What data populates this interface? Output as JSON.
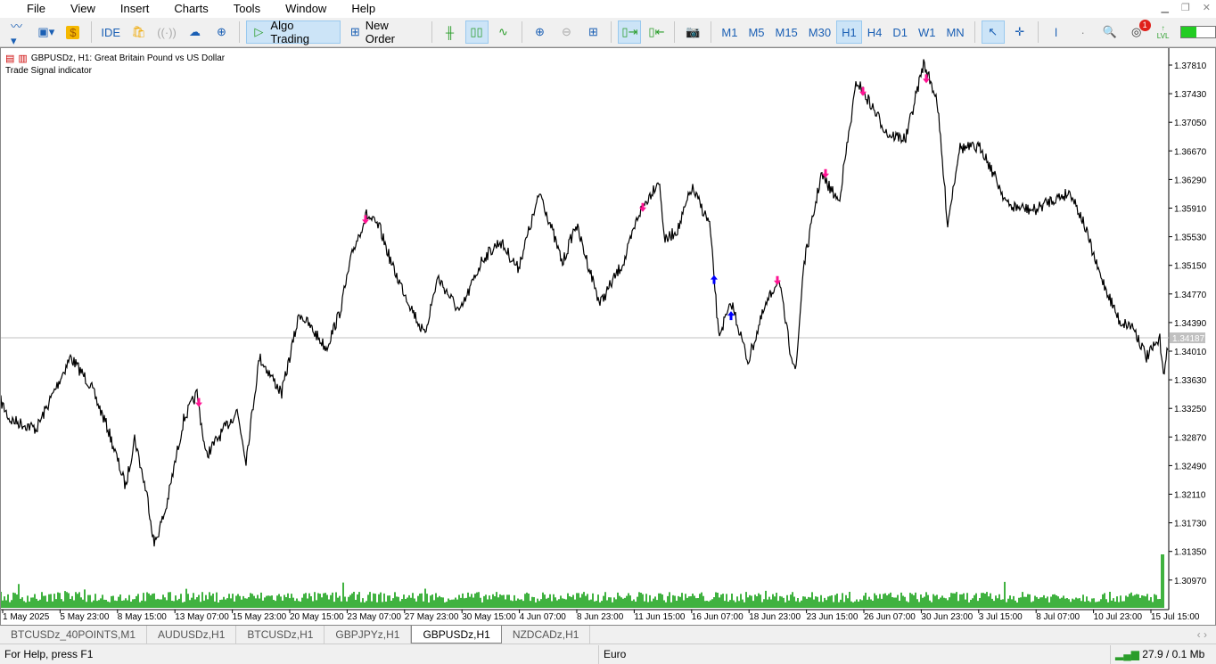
{
  "menu": [
    "File",
    "View",
    "Insert",
    "Charts",
    "Tools",
    "Window",
    "Help"
  ],
  "toolbar": {
    "ide": "IDE",
    "algo_trading": "Algo Trading",
    "new_order": "New Order",
    "timeframes": [
      "M1",
      "M5",
      "M15",
      "M30",
      "H1",
      "H4",
      "D1",
      "W1",
      "MN"
    ],
    "active_timeframe": "H1",
    "notification_count": "1",
    "lvl": "LVL"
  },
  "chart": {
    "symbol_title": "GBPUSDz, H1:  Great Britain Pound vs US Dollar",
    "indicator": "Trade Signal indicator",
    "current_price": "1.34187",
    "price_ticks": [
      "1.37810",
      "1.37430",
      "1.37050",
      "1.36670",
      "1.36290",
      "1.35910",
      "1.35530",
      "1.35150",
      "1.34770",
      "1.34390",
      "1.34010",
      "1.33630",
      "1.33250",
      "1.32870",
      "1.32490",
      "1.32110",
      "1.31730",
      "1.31350",
      "1.30970"
    ],
    "time_ticks": [
      "1 May 2025",
      "5 May 23:00",
      "8 May 15:00",
      "13 May 07:00",
      "15 May 23:00",
      "20 May 15:00",
      "23 May 07:00",
      "27 May 23:00",
      "30 May 15:00",
      "4 Jun 07:00",
      "8 Jun 23:00",
      "11 Jun 15:00",
      "16 Jun 07:00",
      "18 Jun 23:00",
      "23 Jun 15:00",
      "26 Jun 07:00",
      "30 Jun 23:00",
      "3 Jul 15:00",
      "8 Jul 07:00",
      "10 Jul 23:00",
      "15 Jul 15:00"
    ],
    "colors": {
      "price_line": "#000000",
      "sell_arrow": "#ff1493",
      "buy_arrow": "#0000ff",
      "volume": "#009900",
      "bid_line": "#c0c0c0"
    }
  },
  "chart_data": {
    "type": "line",
    "symbol": "GBPUSDz",
    "timeframe": "H1",
    "ylim": [
      1.3059,
      1.3819
    ],
    "bars": [
      0,
      10,
      40,
      78,
      100,
      120,
      140,
      150,
      165,
      172,
      185,
      205,
      220,
      230,
      265,
      275,
      290,
      315,
      335,
      365,
      380,
      395,
      410,
      425,
      440,
      475,
      490,
      515,
      540,
      560,
      580,
      605,
      630,
      645,
      672,
      700,
      715,
      738,
      745,
      760,
      775,
      795,
      800,
      805,
      820,
      838,
      855,
      872,
      885,
      892,
      900,
      920,
      940,
      960,
      975,
      995,
      1015,
      1035,
      1050,
      1062,
      1075,
      1100,
      1130,
      1160,
      1175,
      1200,
      1215,
      1230,
      1255,
      1270,
      1285,
      1300,
      1305,
      1310
    ],
    "close": [
      1.3334,
      1.331,
      1.3298,
      1.3393,
      1.3357,
      1.3298,
      1.3221,
      1.3286,
      1.3203,
      1.3144,
      1.3191,
      1.331,
      1.3345,
      1.3262,
      1.3322,
      1.3257,
      1.3393,
      1.3345,
      1.3452,
      1.3405,
      1.3452,
      1.3535,
      1.3582,
      1.3564,
      1.3511,
      1.3422,
      1.3499,
      1.3452,
      1.3523,
      1.3547,
      1.3511,
      1.3612,
      1.3517,
      1.357,
      1.3464,
      1.3523,
      1.3582,
      1.3629,
      1.3547,
      1.3564,
      1.3618,
      1.357,
      1.3499,
      1.3422,
      1.3464,
      1.3387,
      1.3452,
      1.3499,
      1.3405,
      1.3375,
      1.3511,
      1.3635,
      1.36,
      1.376,
      1.373,
      1.3689,
      1.3683,
      1.3783,
      1.3736,
      1.357,
      1.3671,
      1.3671,
      1.3594,
      1.3588,
      1.36,
      1.3612,
      1.357,
      1.3511,
      1.344,
      1.3434,
      1.3393,
      1.3416,
      1.3369,
      1.3416
    ],
    "sell_signals": [
      [
        222,
        1.3334
      ],
      [
        409,
        1.3577
      ],
      [
        720,
        1.3593
      ],
      [
        871,
        1.3496
      ],
      [
        925,
        1.3638
      ],
      [
        967,
        1.3747
      ],
      [
        1038,
        1.3764
      ]
    ],
    "buy_signals": [
      [
        800,
        1.3495
      ],
      [
        819,
        1.3447
      ]
    ]
  },
  "tabs": [
    "BTCUSDz_40POINTS,M1",
    "AUDUSDz,H1",
    "BTCUSDz,H1",
    "GBPJPYz,H1",
    "GBPUSDz,H1",
    "NZDCADz,H1"
  ],
  "active_tab": "GBPUSDz,H1",
  "status": {
    "help": "For Help, press F1",
    "profile": "Euro",
    "traffic": "27.9 / 0.1 Mb"
  }
}
